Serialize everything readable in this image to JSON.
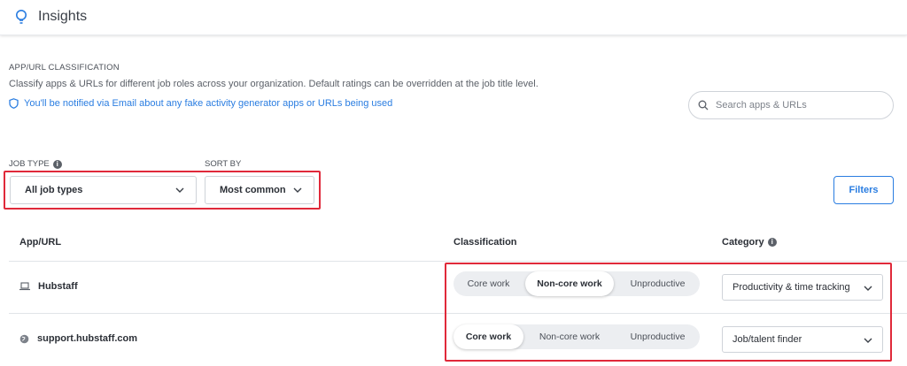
{
  "header": {
    "title": "Insights",
    "icon": "lightbulb-icon",
    "accent": "#2a7de1"
  },
  "section": {
    "label": "APP/URL CLASSIFICATION",
    "description": "Classify apps & URLs for different job roles across your organization. Default ratings can be overridden at the job title level.",
    "notice": "You'll be notified via Email about any fake activity generator apps or URLs being used"
  },
  "search": {
    "placeholder": "Search apps & URLs",
    "value": ""
  },
  "job_type": {
    "label": "JOB TYPE",
    "value": "All job types"
  },
  "sort_by": {
    "label": "SORT BY",
    "value": "Most common"
  },
  "filters": {
    "label": "Filters"
  },
  "table": {
    "headers": {
      "app": "App/URL",
      "classification": "Classification",
      "category": "Category"
    },
    "classification_options": [
      "Core work",
      "Non-core work",
      "Unproductive"
    ],
    "rows": [
      {
        "name": "Hubstaff",
        "icon": "laptop-icon",
        "classification": "Non-core work",
        "category": "Productivity & time tracking"
      },
      {
        "name": "support.hubstaff.com",
        "icon": "globe-icon",
        "classification": "Core work",
        "category": "Job/talent finder"
      }
    ]
  },
  "colors": {
    "link": "#2a7de1",
    "highlight": "#e0293a"
  }
}
